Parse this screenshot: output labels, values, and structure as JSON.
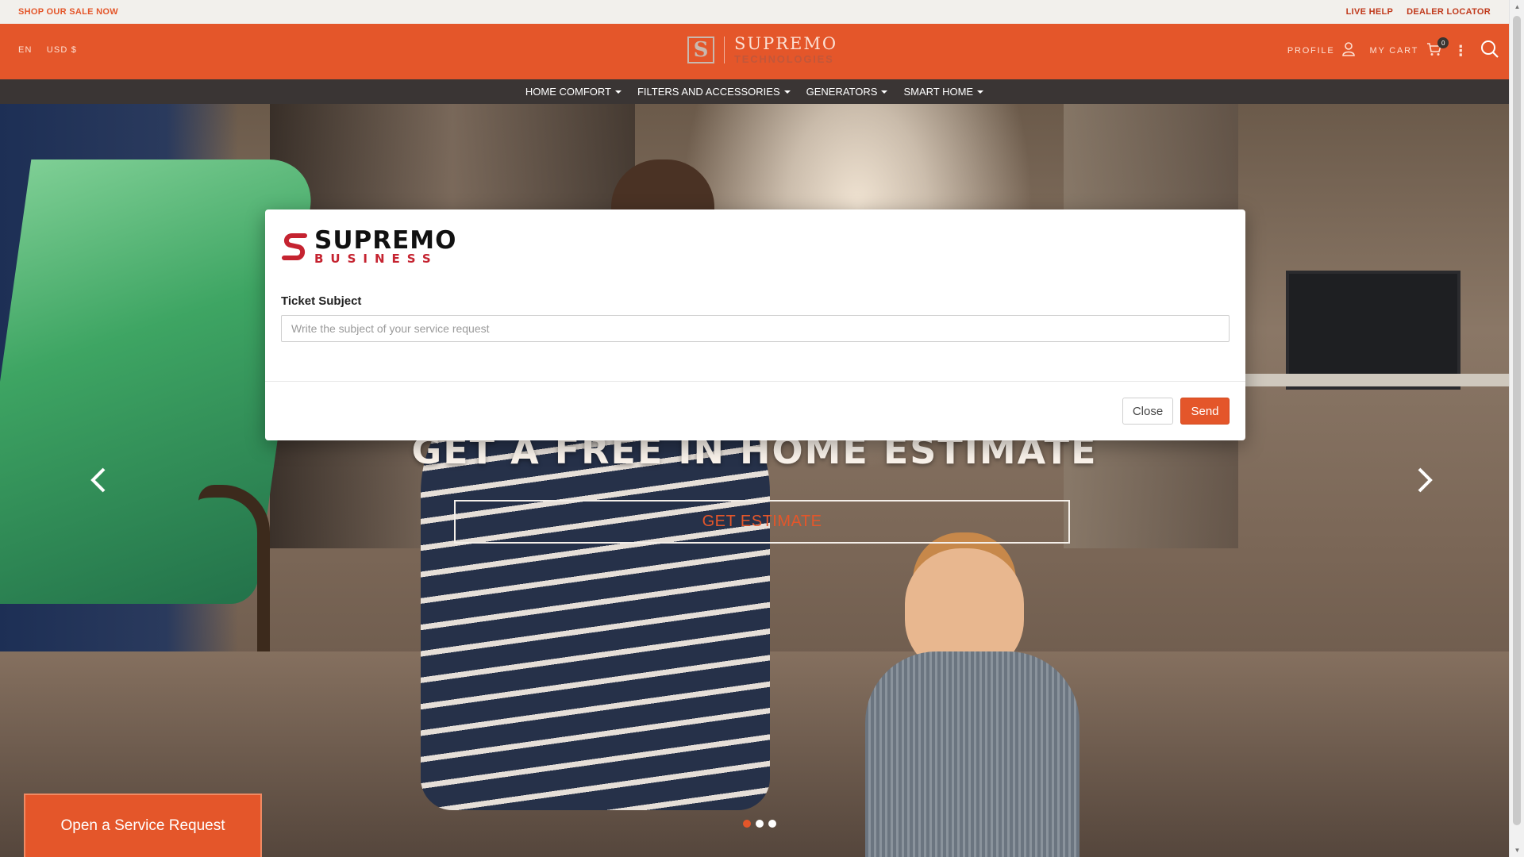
{
  "topbar": {
    "sale_link": "SHOP OUR SALE NOW",
    "live_help": "LIVE HELP",
    "dealer_locator": "DEALER LOCATOR"
  },
  "header": {
    "language": "EN",
    "currency": "USD $",
    "logo_line1": "SUPREMO",
    "logo_line2": "TECHNOLOGIES",
    "logo_mark": "S",
    "profile_label": "PROFILE",
    "cart_label": "MY CART",
    "cart_count": "0",
    "icons": {
      "profile": "user-icon",
      "cart": "cart-icon",
      "more": "more-vertical-icon",
      "search": "search-icon"
    }
  },
  "nav": {
    "items": [
      {
        "label": "HOME COMFORT"
      },
      {
        "label": "FILTERS AND ACCESSORIES"
      },
      {
        "label": "GENERATORS"
      },
      {
        "label": "SMART HOME"
      }
    ]
  },
  "hero": {
    "title": "GET A FREE IN HOME ESTIMATE",
    "button_label": "GET ESTIMATE",
    "slides": 3,
    "active_slide": 1,
    "prev_icon": "chevron-left-icon",
    "next_icon": "chevron-right-icon"
  },
  "service_button": {
    "label": "Open a Service Request"
  },
  "modal": {
    "brand_line1": "SUPREMO",
    "brand_line2": "BUSINESS",
    "field_label": "Ticket Subject",
    "field_placeholder": "Write the subject of your service request",
    "field_value": "",
    "close_label": "Close",
    "send_label": "Send"
  },
  "colors": {
    "brand_orange": "#e4562a",
    "nav_dark": "#3a3534",
    "brand_red": "#c52330"
  }
}
